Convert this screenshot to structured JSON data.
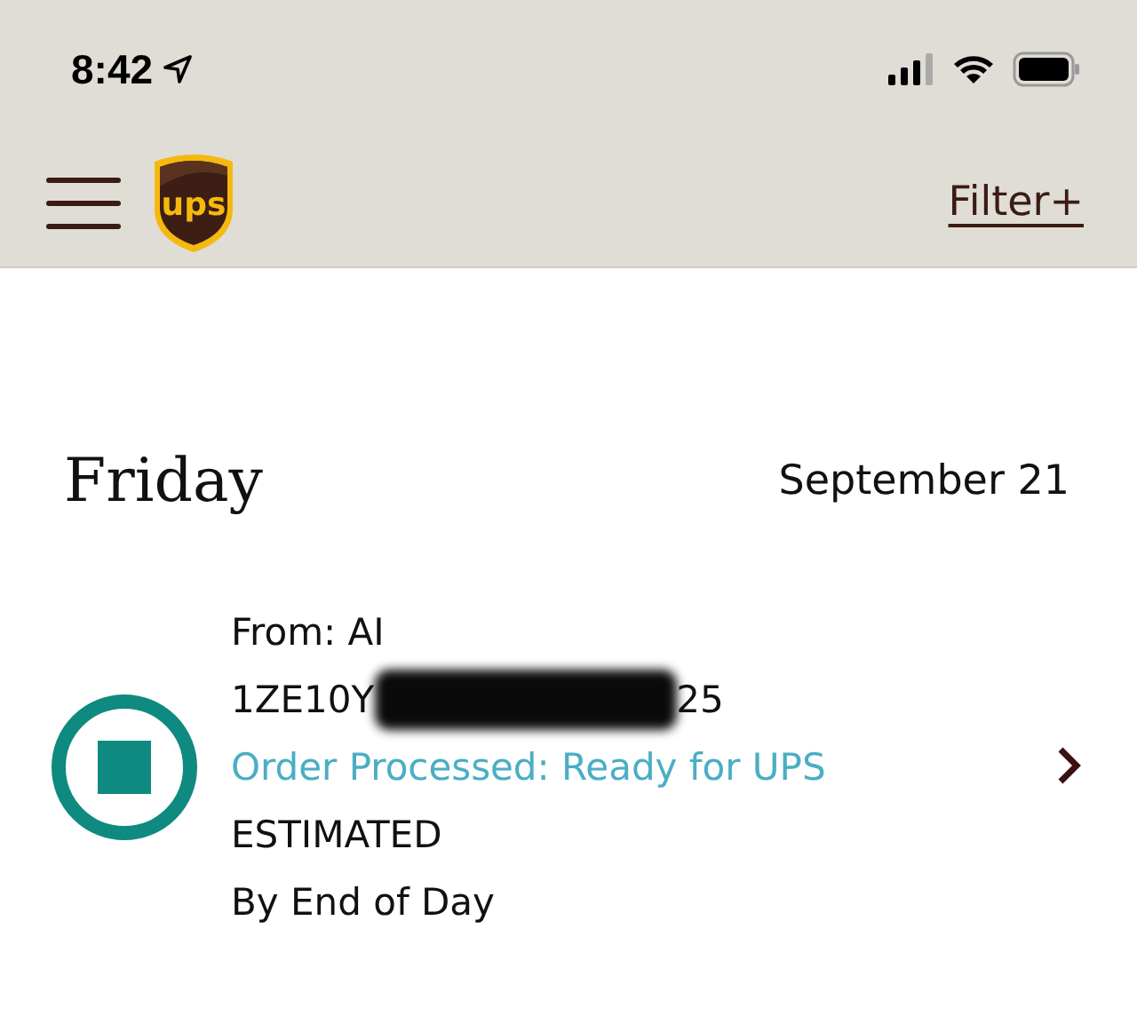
{
  "status_bar": {
    "time": "8:42"
  },
  "header": {
    "logo_text": "ups",
    "filter_link": "Filter+"
  },
  "day": {
    "weekday": "Friday",
    "date": "September 21"
  },
  "shipments": [
    {
      "from": "From: AI",
      "tracking_start": "1ZE10Y",
      "tracking_end": "25",
      "status": "Order Processed: Ready for UPS",
      "estimate_label": "ESTIMATED",
      "estimate": "By End of Day"
    }
  ]
}
